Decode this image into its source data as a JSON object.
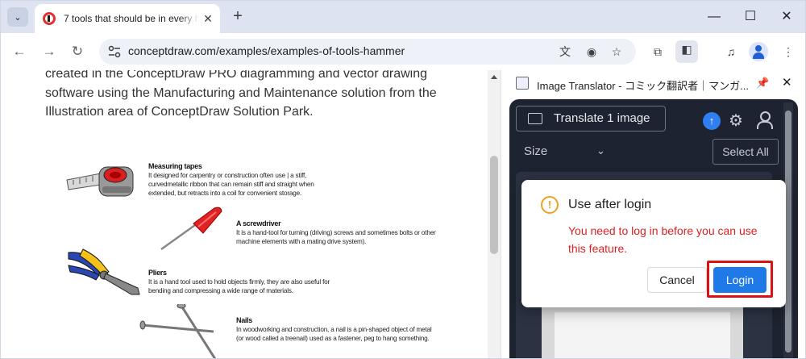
{
  "browser": {
    "tab_title": "7 tools that should be in every h",
    "url": "conceptdraw.com/examples/examples-of-tools-hammer",
    "icons": [
      "tab-list-icon",
      "close-icon",
      "new-tab-icon",
      "minimize-icon",
      "maximize-icon",
      "back-icon",
      "forward-icon",
      "reload-icon",
      "site-info-icon",
      "translate-icon",
      "eye-off-icon",
      "star-icon",
      "extensions-icon",
      "side-panel-icon",
      "media-icon",
      "profile-icon",
      "menu-icon"
    ]
  },
  "page": {
    "paragraph": "created in the ConceptDraw PRO diagramming and vector drawing software using the Manufacturing and Maintenance solution from the Illustration area of ConceptDraw Solution Park.",
    "tools": [
      {
        "title": "Measuring tapes",
        "desc": "It designed for carpentry or construction often use | a stiff, curvedmetallic ribbon that can remain stiff and straight when extended, but retracts into a coil for convenient storage."
      },
      {
        "title": "A screwdriver",
        "desc": "It is a hand-tool for turning (driving) screws and sometimes bolts or other machine elements with a mating drive system)."
      },
      {
        "title": "Pliers",
        "desc": "It is a hand tool used to hold objects firmly, they are also useful for bending and compressing a wide range of materials."
      },
      {
        "title": "Nails",
        "desc": "In woodworking and construction, a nail is a pin-shaped object of metal (or wood called a treenail) used as a fastener, peg to hang something."
      }
    ]
  },
  "side_panel": {
    "title": "Image Translator - コミック翻訳者｜マンガ...",
    "translate_btn": "Translate 1 image",
    "size_label": "Size",
    "select_all": "Select All"
  },
  "dialog": {
    "title": "Use after login",
    "message": "You need to log in before you can use this feature.",
    "cancel": "Cancel",
    "login": "Login"
  },
  "colors": {
    "accent": "#1f7ae8",
    "error": "#e02020",
    "warning": "#f0a020",
    "highlight": "#d11111"
  }
}
